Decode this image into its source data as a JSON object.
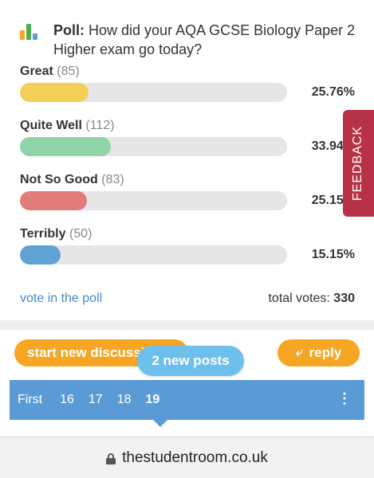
{
  "poll": {
    "prefix": "Poll:",
    "question": "How did your AQA GCSE Biology Paper 2 Higher exam go today?",
    "icon": "poll-bars-icon",
    "icon_colors": [
      "#f6a623",
      "#4caf50",
      "#5b9bd5"
    ],
    "options": [
      {
        "label": "Great",
        "count": "(85)",
        "percent": "25.76%",
        "fraction": 0.2576,
        "color": "#f3cf58"
      },
      {
        "label": "Quite Well",
        "count": "(112)",
        "percent": "33.94%",
        "fraction": 0.3394,
        "color": "#8fd3a8"
      },
      {
        "label": "Not So Good",
        "count": "(83)",
        "percent": "25.15%",
        "fraction": 0.2515,
        "color": "#e37b7b"
      },
      {
        "label": "Terribly",
        "count": "(50)",
        "percent": "15.15%",
        "fraction": 0.1515,
        "color": "#5fa3d3"
      }
    ],
    "vote_link": "vote in the poll",
    "total_label": "total votes:",
    "total_value": "330"
  },
  "feedback": {
    "label": "FEEDBACK",
    "color": "#b83247"
  },
  "actions": {
    "start_label": "start new discussion",
    "reply_label": "reply",
    "reply_icon": "reply-arrow-icon",
    "new_posts_label": "2 new posts"
  },
  "pager": {
    "first_label": "First",
    "pages": [
      "16",
      "17",
      "18"
    ],
    "current": "19",
    "more_icon": "more-vertical-icon"
  },
  "browser": {
    "url": "thestudentroom.co.uk",
    "lock_icon": "lock-icon"
  }
}
